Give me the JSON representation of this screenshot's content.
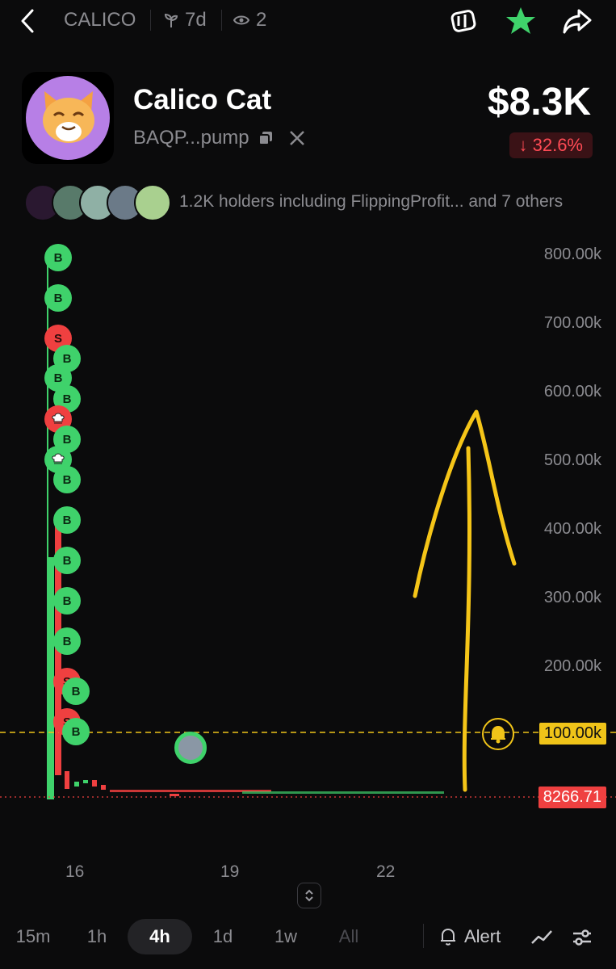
{
  "header": {
    "ticker": "CALICO",
    "age": "7d",
    "views": "2"
  },
  "token": {
    "name": "Calico Cat",
    "address": "BAQP...pump",
    "price": "$8.3K",
    "change": "↓ 32.6%"
  },
  "holders": {
    "text": "1.2K holders including FlippingProfit... and 7 others"
  },
  "chart": {
    "y_labels": [
      "800.00k",
      "700.00k",
      "600.00k",
      "500.00k",
      "400.00k",
      "300.00k",
      "200.00k"
    ],
    "alert_level": "100.00k",
    "current_price": "8266.71",
    "x_labels": [
      "16",
      "19",
      "22"
    ],
    "marker_buy": "B",
    "marker_sell": "S"
  },
  "chart_data": {
    "type": "candlestick",
    "y_ticks": [
      200000,
      300000,
      400000,
      500000,
      600000,
      700000,
      800000
    ],
    "x_ticks": [
      "16",
      "19",
      "22"
    ],
    "alert_line": 100000,
    "last_price": 8266.71
  },
  "timeframes": {
    "items": [
      "15m",
      "1h",
      "4h",
      "1d",
      "1w",
      "All"
    ],
    "active": "4h"
  },
  "toolbar": {
    "alert_label": "Alert"
  },
  "colors": {
    "up": "#3fd26b",
    "down": "#ef4040",
    "accent": "#f0c419"
  }
}
